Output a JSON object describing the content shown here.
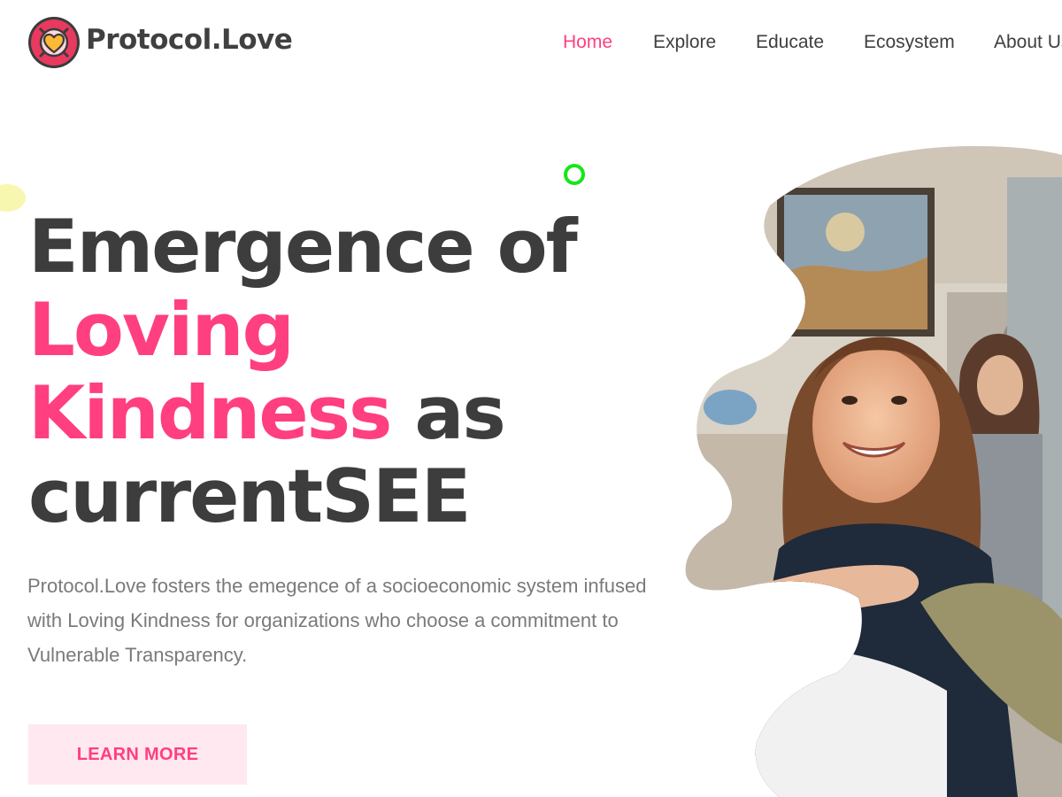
{
  "brand": {
    "name": "Protocol.Love",
    "logo_icon": "heart-in-lifebuoy-icon"
  },
  "nav": {
    "items": [
      {
        "label": "Home",
        "active": true
      },
      {
        "label": "Explore",
        "active": false
      },
      {
        "label": "Educate",
        "active": false
      },
      {
        "label": "Ecosystem",
        "active": false
      },
      {
        "label": "About Us",
        "active": false
      }
    ]
  },
  "hero": {
    "headline": {
      "line1": "Emergence of",
      "line2_accent": "Loving",
      "line3_accent": "Kindness",
      "line3_rest": " as",
      "line4": "currentSEE"
    },
    "description": "Protocol.Love fosters the emegence of a socioeconomic system infused with Loving Kindness for organizations who choose a commitment to Vulnerable Transparency.",
    "cta_label": "LEARN MORE"
  },
  "colors": {
    "accent": "#ff3f7f",
    "text_dark": "#3d3d3d",
    "text_muted": "#7a7a7a",
    "button_bg": "#ffe8ef",
    "logo_ring": "#e8395f",
    "logo_heart": "#ffb935",
    "decor_yellow": "#f7f7b0",
    "decor_green": "#16e616"
  }
}
